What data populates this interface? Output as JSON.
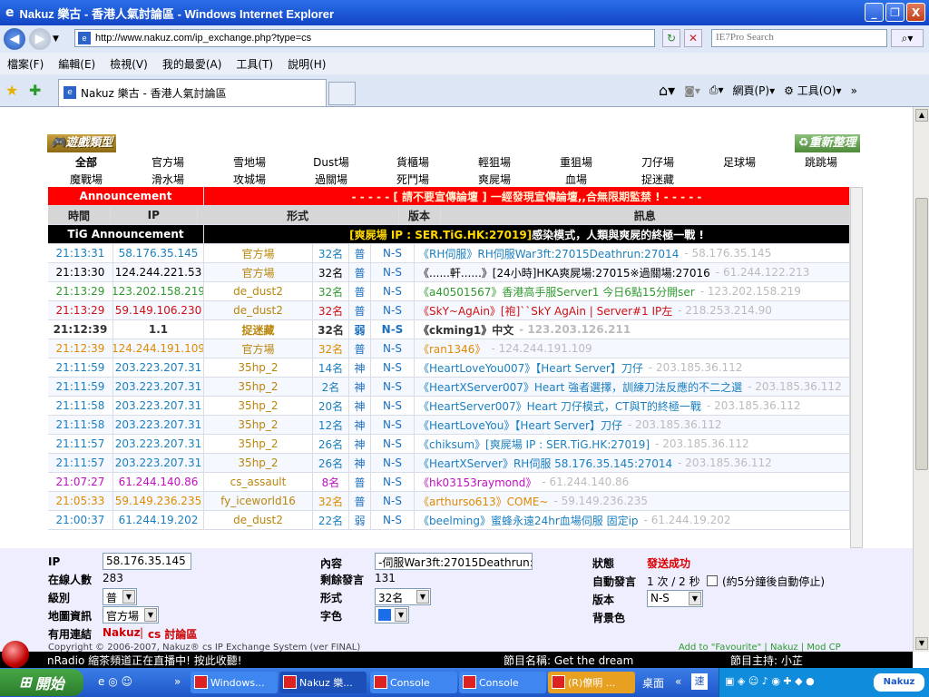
{
  "window": {
    "title": "Nakuz 樂古 - 香港人氣討論區 - Windows Internet Explorer",
    "min": "_",
    "max": "❐",
    "close": "X"
  },
  "address": {
    "url": "http://www.nakuz.com/ip_exchange.php?type=cs",
    "search_placeholder": "IE7Pro Search"
  },
  "menu": [
    "檔案(F)",
    "編輯(E)",
    "檢視(V)",
    "我的最愛(A)",
    "工具(T)",
    "說明(H)"
  ],
  "tab": {
    "label": "Nakuz 樂古 - 香港人氣討論區"
  },
  "toolbar_right": {
    "page": "網頁(P)",
    "tools": "工具(O)"
  },
  "section": {
    "game_type": "遊戲類型",
    "refresh": "重新整理"
  },
  "categories_row1": [
    "全部",
    "官方場",
    "雪地場",
    "Dust場",
    "貨櫃場",
    "輕狙場",
    "重狙場",
    "刀仔場",
    "足球場",
    "跳跳場"
  ],
  "categories_row2": [
    "魔戰場",
    "滑水場",
    "攻城場",
    "過關場",
    "死鬥場",
    "爽屍場",
    "血場",
    "捉迷藏"
  ],
  "announcement": {
    "label": "Announcement",
    "text": "- - - - - [ 請不要宣傳論壇 ] 一經發現宣傳論壇,,合無限期監禁 ! - - - - -"
  },
  "headers": {
    "time": "時間",
    "ip": "IP",
    "type": "形式",
    "version": "版本",
    "message": "訊息"
  },
  "tig": {
    "label": "TiG Announcement",
    "highlight": "[爽屍場 IP : SER.TiG.HK:27019]",
    "text": " 感染模式，人類與爽屍的終極一戰 !"
  },
  "rows": [
    {
      "time": "21:13:31",
      "ip": "58.176.35.145",
      "type": "官方場",
      "count": "32名",
      "diff": "普",
      "ver": "N-S",
      "msg": "《RH伺服》RH伺服War3ft:27015Deathrun:27014",
      "msgip": "- 58.176.35.145",
      "color": "#1a7fc0"
    },
    {
      "time": "21:13:30",
      "ip": "124.244.221.53",
      "type": "官方場",
      "count": "32名",
      "diff": "普",
      "ver": "N-S",
      "msg": "《......軒......》[24小時]HKA爽屍場:27015※過關場:27016",
      "msgip": "- 61.244.122.213",
      "color": "#000000"
    },
    {
      "time": "21:13:29",
      "ip": "123.202.158.219",
      "type": "de_dust2",
      "count": "32名",
      "diff": "普",
      "ver": "N-S",
      "msg": "《a40501567》香港高手服Server1 今日6點15分開ser",
      "msgip": "- 123.202.158.219",
      "color": "#2e9a2e"
    },
    {
      "time": "21:13:29",
      "ip": "59.149.106.230",
      "type": "de_dust2",
      "count": "32名",
      "diff": "普",
      "ver": "N-S",
      "msg": "《SkY~AgAin》[袍]``SkY AgAin | Server#1 IP左",
      "msgip": "- 218.253.214.90",
      "color": "#d01010"
    },
    {
      "time": "21:12:39",
      "ip": "1.1",
      "type": "捉迷藏",
      "count": "32名",
      "diff": "弱",
      "ver": "N-S",
      "msg": "《ckming1》中文",
      "msgip": "- 123.203.126.211",
      "color": "#333333",
      "bold": true
    },
    {
      "time": "21:12:39",
      "ip": "124.244.191.109",
      "type": "官方場",
      "count": "32名",
      "diff": "普",
      "ver": "N-S",
      "msg": "《ran1346》",
      "msgip": "- 124.244.191.109",
      "color": "#e08a00"
    },
    {
      "time": "21:11:59",
      "ip": "203.223.207.31",
      "type": "35hp_2",
      "count": "14名",
      "diff": "神",
      "ver": "N-S",
      "msg": "《HeartLoveYou007》【Heart Server】刀仔",
      "msgip": "- 203.185.36.112",
      "color": "#1a7fc0"
    },
    {
      "time": "21:11:59",
      "ip": "203.223.207.31",
      "type": "35hp_2",
      "count": "2名",
      "diff": "神",
      "ver": "N-S",
      "msg": "《HeartXServer007》Heart 強者選擇，訓練刀法反應的不二之選",
      "msgip": "- 203.185.36.112",
      "color": "#1a7fc0"
    },
    {
      "time": "21:11:58",
      "ip": "203.223.207.31",
      "type": "35hp_2",
      "count": "20名",
      "diff": "神",
      "ver": "N-S",
      "msg": "《HeartServer007》Heart 刀仔模式，CT與T的終極一戰",
      "msgip": "- 203.185.36.112",
      "color": "#1a7fc0"
    },
    {
      "time": "21:11:58",
      "ip": "203.223.207.31",
      "type": "35hp_2",
      "count": "12名",
      "diff": "神",
      "ver": "N-S",
      "msg": "《HeartLoveYou》【Heart Server】刀仔",
      "msgip": "- 203.185.36.112",
      "color": "#1a7fc0"
    },
    {
      "time": "21:11:57",
      "ip": "203.223.207.31",
      "type": "35hp_2",
      "count": "26名",
      "diff": "神",
      "ver": "N-S",
      "msg": "《chiksum》[爽屍場 IP : SER.TiG.HK:27019]",
      "msgip": "- 203.185.36.112",
      "color": "#1a7fc0"
    },
    {
      "time": "21:11:57",
      "ip": "203.223.207.31",
      "type": "35hp_2",
      "count": "26名",
      "diff": "神",
      "ver": "N-S",
      "msg": "《HeartXServer》RH伺服 58.176.35.145:27014",
      "msgip": "- 203.185.36.112",
      "color": "#1a7fc0"
    },
    {
      "time": "21:07:27",
      "ip": "61.244.140.86",
      "type": "cs_assault",
      "count": "8名",
      "diff": "普",
      "ver": "N-S",
      "msg": "《hk03153raymond》",
      "msgip": "- 61.244.140.86",
      "color": "#c010c0"
    },
    {
      "time": "21:05:33",
      "ip": "59.149.236.235",
      "type": "fy_iceworld16",
      "count": "32名",
      "diff": "普",
      "ver": "N-S",
      "msg": "《arthurso613》COME~",
      "msgip": "- 59.149.236.235",
      "color": "#e08a00"
    },
    {
      "time": "21:00:37",
      "ip": "61.244.19.202",
      "type": "de_dust2",
      "count": "22名",
      "diff": "弱",
      "ver": "N-S",
      "msg": "《beelming》蜜蜂永遠24hr血場伺服 固定ip",
      "msgip": "- 61.244.19.202",
      "color": "#1a7fc0"
    }
  ],
  "form": {
    "ip_label": "IP",
    "ip_value": "58.176.35.145",
    "online_label": "在線人數",
    "online_value": "283",
    "level_label": "級別",
    "level_value": "普",
    "map_label": "地圖資訊",
    "map_value": "官方場",
    "links_label": "有用連結",
    "link1": "Nakuz",
    "sep": "|",
    "link2": "cs 討論區",
    "content_label": "內容",
    "content_value": "-伺服War3ft:27015Deathrun:2",
    "remaining_label": "剩餘發言",
    "remaining_value": "131",
    "form_label": "形式",
    "form_value": "32名",
    "color_label": "字色",
    "status_label": "狀態",
    "status_value": "發送成功",
    "auto_label": "自動發言",
    "auto_value": "1 次 / 2 秒",
    "auto_note": "(約5分鐘後自動停止)",
    "version_label": "版本",
    "version_value": "N-S",
    "bg_label": "背景色",
    "copyright": "Copyright © 2006-2007, Nakuz® cs IP Exchange System (ver FINAL)",
    "add_fav": "Add to \"Favourite\" | Nakuz | Mod CP"
  },
  "radio": {
    "left": "nRadio 縮茶頻道正在直播中! 按此收聽!",
    "song": "節目名稱: Get the dream",
    "host": "節目主持: 小芷"
  },
  "taskbar": {
    "start": "開始",
    "items": [
      "Windows...",
      "Nakuz 樂...",
      "Console",
      "Console",
      "(R)僚明 ...",
      "桌面"
    ]
  }
}
